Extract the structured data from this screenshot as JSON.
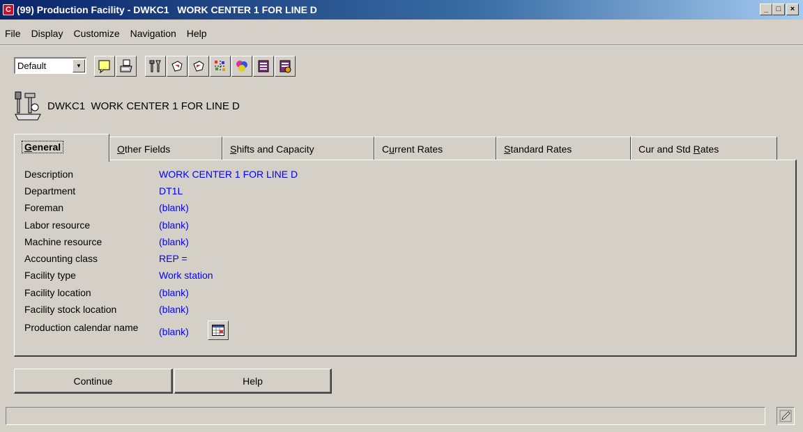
{
  "window": {
    "app_icon_glyph": "C",
    "title": "(99) Production Facility - DWKC1   WORK CENTER 1 FOR LINE D",
    "minimize_glyph": "_",
    "maximize_glyph": "□",
    "close_glyph": "×"
  },
  "menu": {
    "items": [
      "File",
      "Display",
      "Customize",
      "Navigation",
      "Help"
    ]
  },
  "toolbar": {
    "view": "Default",
    "buttons": [
      {
        "icon": "note-icon"
      },
      {
        "icon": "print-icon"
      },
      {
        "icon": "tools-icon"
      },
      {
        "icon": "hand-point-icon"
      },
      {
        "icon": "hand-back-icon"
      },
      {
        "icon": "scatter-icon"
      },
      {
        "icon": "colors-icon"
      },
      {
        "icon": "book-icon"
      },
      {
        "icon": "books-icon"
      }
    ]
  },
  "header": {
    "code": "DWKC1",
    "name": "WORK CENTER 1 FOR LINE D"
  },
  "tabs": [
    {
      "pre": "",
      "u": "G",
      "post": "eneral",
      "active": true
    },
    {
      "pre": "",
      "u": "O",
      "post": "ther Fields"
    },
    {
      "pre": "",
      "u": "S",
      "post": "hifts and Capacity"
    },
    {
      "pre": "C",
      "u": "u",
      "post": "rrent Rates"
    },
    {
      "pre": "",
      "u": "S",
      "post": "tandard Rates"
    },
    {
      "pre": "Cur and Std ",
      "u": "R",
      "post": "ates"
    }
  ],
  "fields": [
    {
      "label": "Description",
      "value": "WORK CENTER 1 FOR LINE D"
    },
    {
      "label": "Department",
      "value": "DT1L"
    },
    {
      "label": "Foreman",
      "value": "(blank)"
    },
    {
      "label": "Labor resource",
      "value": "(blank)"
    },
    {
      "label": "Machine resource",
      "value": "(blank)"
    },
    {
      "label": "Accounting class",
      "value": "REP ="
    },
    {
      "label": "Facility type",
      "value": "Work station"
    },
    {
      "label": "Facility location",
      "value": "(blank)"
    },
    {
      "label": "Facility stock location",
      "value": "(blank)"
    },
    {
      "label": "Production calendar name",
      "value": "(blank)"
    }
  ],
  "buttons": {
    "continue": "Continue",
    "help": "Help"
  },
  "colors": {
    "value_text": "#0000ff",
    "titlebar": "#0a246a",
    "background": "#d4d0c8"
  }
}
